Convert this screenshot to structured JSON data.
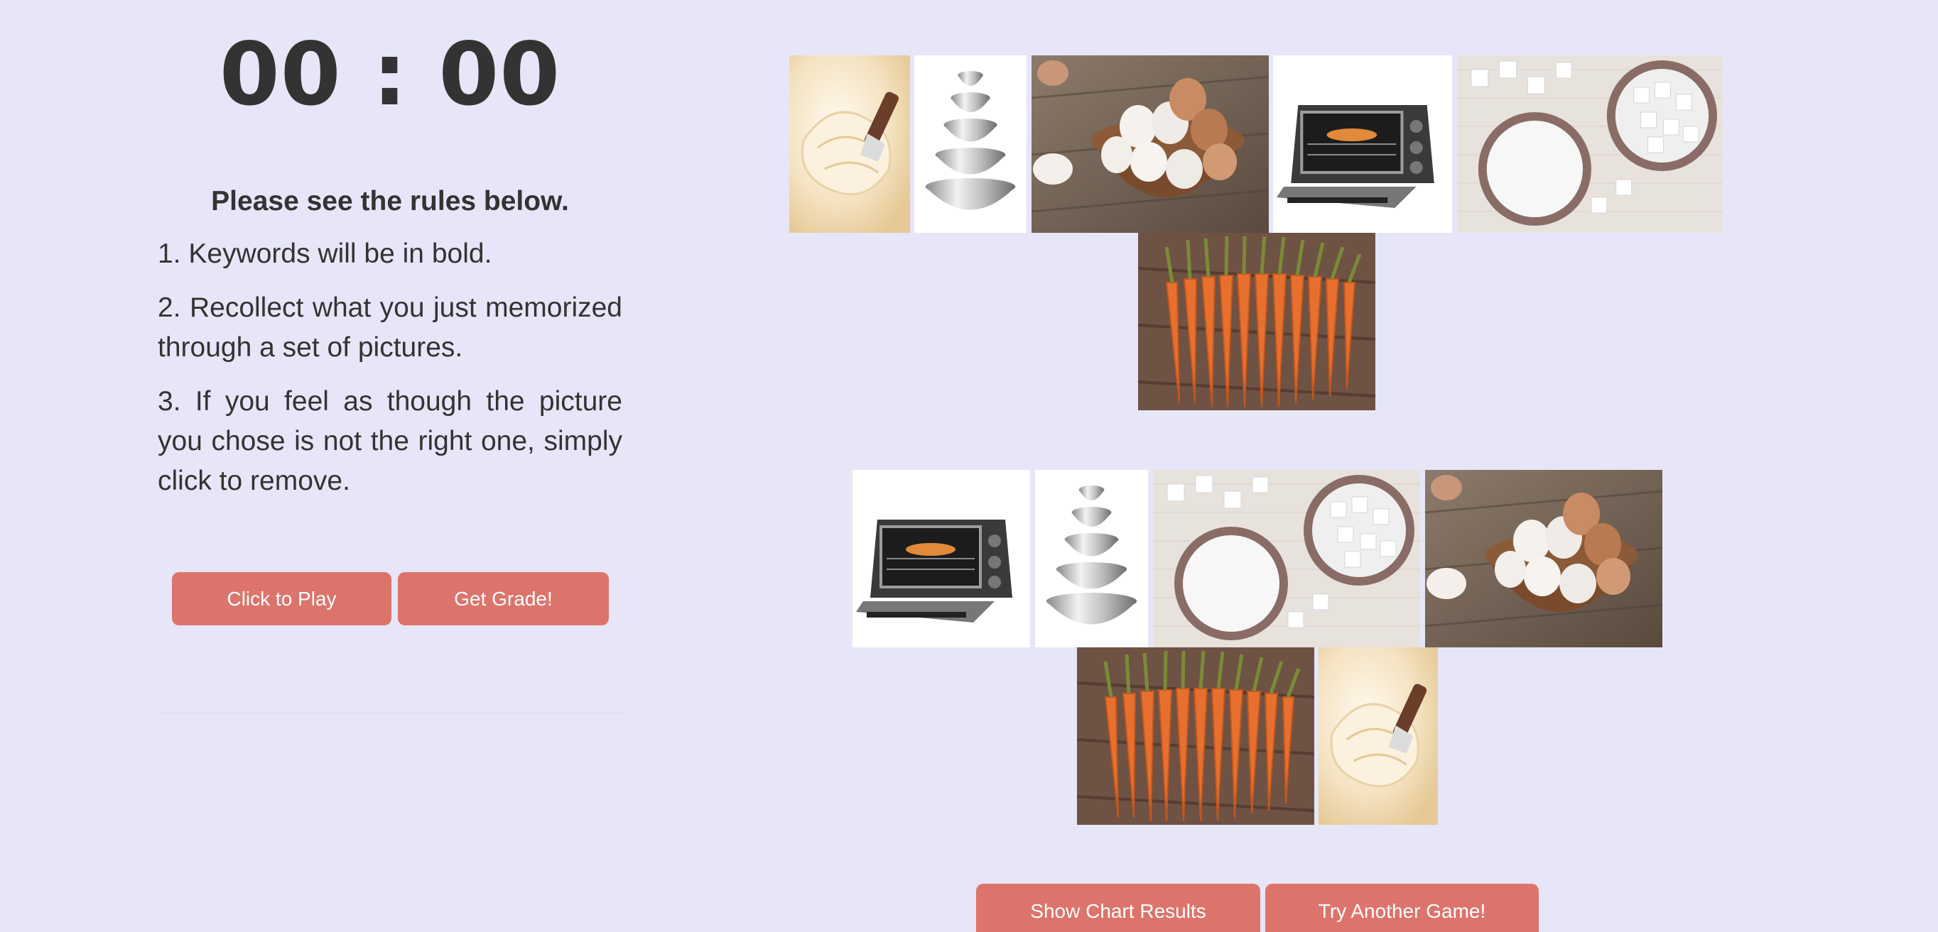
{
  "timer": {
    "display": "00 : 00"
  },
  "rules": {
    "title": "Please see the rules below.",
    "items": [
      "1. Keywords will be in bold.",
      "2. Recollect what you just memorized through a set of pictures.",
      "3. If you feel as though the picture you chose is not the right one, simply click to remove."
    ]
  },
  "buttons": {
    "play": "Click to Play",
    "grade": "Get Grade!",
    "chart": "Show Chart Results",
    "another": "Try Another Game!"
  },
  "memorized_set": [
    "butter",
    "mixing-bowls",
    "eggs",
    "toaster-oven",
    "sugar",
    "carrots"
  ],
  "chosen_set": [
    "toaster-oven",
    "mixing-bowls",
    "sugar",
    "eggs",
    "carrots",
    "butter"
  ],
  "colors": {
    "background": "#e6e6f8",
    "button": "#dd746c",
    "text": "#333333"
  }
}
